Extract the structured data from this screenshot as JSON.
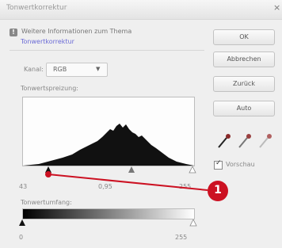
{
  "window": {
    "title": "Tonwertkorrektur",
    "close_glyph": "×"
  },
  "warning": {
    "icon_glyph": "!",
    "text": "Weitere Informationen zum Thema",
    "link": "Tonwertkorrektur"
  },
  "channel": {
    "label": "Kanal:",
    "value": "RGB",
    "arrow": "▼"
  },
  "input_levels": {
    "label": "Tonwertspreizung:",
    "values": [
      "43",
      "0,95",
      "255"
    ]
  },
  "output_levels": {
    "label": "Tonwertumfang:",
    "values": [
      "0",
      "255"
    ]
  },
  "buttons": {
    "ok": "OK",
    "cancel": "Abbrechen",
    "reset": "Zurück",
    "auto": "Auto"
  },
  "preview": {
    "label": "Vorschau",
    "checked": true
  },
  "callout": {
    "number": "1",
    "color": "#cc1122"
  }
}
